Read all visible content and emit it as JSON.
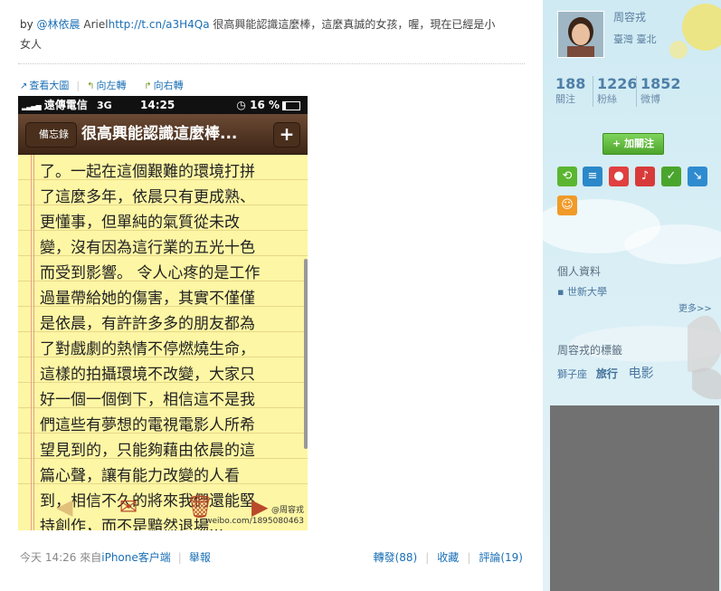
{
  "post": {
    "by": "by",
    "mention": "@林依晨",
    "author": "Ariel",
    "link": "http://t.cn/a3H4Qa",
    "text_line1": " 很高興能認識這麼棒，這麼真誠的女孩，喔，現在已經是小",
    "text_line2": "女人"
  },
  "image_actions": {
    "view_large": "查看大圖",
    "rotate_left": "向左轉",
    "rotate_right": "向右轉"
  },
  "phone": {
    "carrier": "遠傳電信",
    "network": "3G",
    "time": "14:25",
    "battery": "16 %",
    "back_label": "備忘錄",
    "title": "很高興能認識這麼棒...",
    "plus": "+",
    "lines": [
      "了。一起在這個艱難的環境打拼",
      "了這麼多年，依晨只有更成熟、",
      "更懂事，但單純的氣質從未改",
      "變，沒有因為這行業的五光十色",
      "而受到影響。 令人心疼的是工作",
      "過量帶給她的傷害，其實不僅僅",
      "是依晨，有許許多多的朋友都為",
      "了對戲劇的熱情不停燃燒生命，",
      "這樣的拍攝環境不改變，大家只",
      "好一個一個倒下，相信這不是我",
      "們這些有夢想的電視電影人所希",
      "望見到的，只能夠藉由依晨的這",
      "篇心聲，讓有能力改變的人看",
      "到，相信不久的將來我們還能堅",
      "持創作，而不是黯然退場..."
    ],
    "watermark_handle": "@周容戎",
    "watermark_url": "weibo.com/1895080463"
  },
  "meta": {
    "time": "今天 14:26",
    "from": "來自",
    "source": "iPhone客户端",
    "report": "舉報",
    "forward": "轉發(88)",
    "favorite": "收藏",
    "comment": "評論(19)"
  },
  "sidebar": {
    "name": "周容戎",
    "location": "臺灣  臺北",
    "stats": [
      {
        "num": "188",
        "label": "關注"
      },
      {
        "num": "1226",
        "label": "粉絲"
      },
      {
        "num": "1852",
        "label": "微博"
      }
    ],
    "follow": "+ 加關注",
    "profile_title": "個人資料",
    "school": "▪ 世新大學",
    "more": "更多>>",
    "tags_title": "周容戎的標籤",
    "tags": [
      "獅子座",
      "旅行",
      "电影"
    ]
  },
  "colors": {
    "link": "#1a6fb5",
    "note_yellow": "#fdf6a4",
    "navbar_brown": "#4a2f1d",
    "follow_green": "#4da52b"
  }
}
